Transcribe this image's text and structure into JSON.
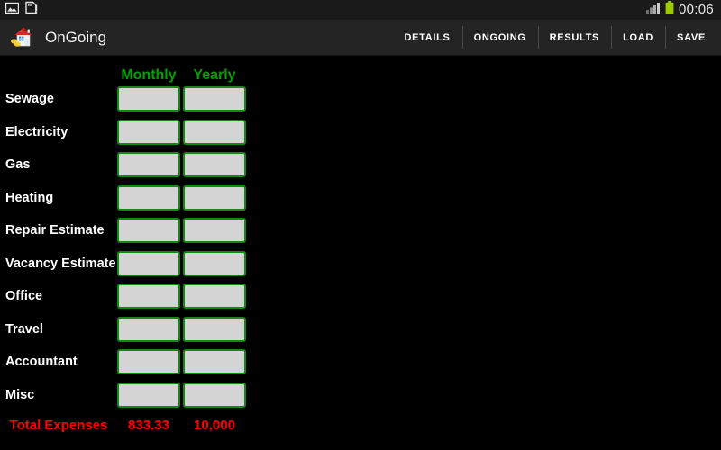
{
  "status_bar": {
    "icons": [
      "image-icon",
      "sdcard-warning-icon"
    ],
    "signal_icon": "signal-bars-icon",
    "battery_icon": "battery-full-icon",
    "battery_color": "#9ccc00",
    "clock": "00:06"
  },
  "action_bar": {
    "app_icon": "house-with-coins-icon",
    "title": "OnGoing",
    "items": [
      {
        "label": "DETAILS"
      },
      {
        "label": "ONGOING"
      },
      {
        "label": "RESULTS"
      },
      {
        "label": "LOAD"
      },
      {
        "label": "SAVE"
      }
    ]
  },
  "form": {
    "columns": [
      {
        "label": "Monthly"
      },
      {
        "label": "Yearly"
      }
    ],
    "header_color": "#00a000",
    "field_fill": "#d4d4d4",
    "field_border": "#108a10",
    "rows": [
      {
        "label": "Sewage",
        "monthly": "",
        "yearly": ""
      },
      {
        "label": "Electricity",
        "monthly": "",
        "yearly": ""
      },
      {
        "label": "Gas",
        "monthly": "",
        "yearly": ""
      },
      {
        "label": "Heating",
        "monthly": "",
        "yearly": ""
      },
      {
        "label": "Repair Estimate",
        "monthly": "",
        "yearly": ""
      },
      {
        "label": "Vacancy Estimate",
        "monthly": "",
        "yearly": ""
      },
      {
        "label": "Office",
        "monthly": "",
        "yearly": ""
      },
      {
        "label": "Travel",
        "monthly": "",
        "yearly": ""
      },
      {
        "label": "Accountant",
        "monthly": "",
        "yearly": ""
      },
      {
        "label": "Misc",
        "monthly": "",
        "yearly": ""
      }
    ],
    "total": {
      "label": "Total Expenses",
      "monthly": "833.33",
      "yearly": "10,000",
      "color": "#ff0000"
    }
  }
}
